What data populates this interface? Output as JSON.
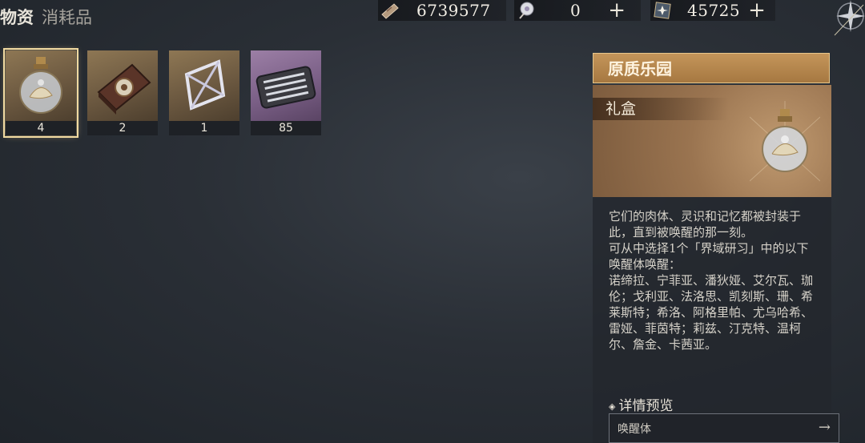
{
  "tabs": {
    "active": "物资",
    "secondary": "消耗品"
  },
  "currencies": [
    {
      "icon": "ticket-currency-icon",
      "value": "6739577",
      "has_plus": false
    },
    {
      "icon": "crystal-currency-icon",
      "value": "0",
      "has_plus": true
    },
    {
      "icon": "star-currency-icon",
      "value": "45725",
      "has_plus": true
    }
  ],
  "plus_symbol": "+",
  "items": [
    {
      "name": "原质乐园",
      "count": "4",
      "icon": "flask-icon",
      "selected": true
    },
    {
      "count": "2",
      "icon": "book-icon",
      "selected": false
    },
    {
      "count": "1",
      "icon": "crystal-frame-icon",
      "selected": false
    },
    {
      "count": "85",
      "icon": "toolkit-icon",
      "selected": false
    }
  ],
  "detail": {
    "title": "原质乐园",
    "type": "礼盒",
    "description": [
      "它们的肉体、灵识和记忆都被封装于此，直到被唤醒的那一刻。",
      "可从中选择1个「界域研习」中的以下唤醒体唤醒：",
      "诺缔拉、宁菲亚、潘狄娅、艾尔瓦、珈伦；戈利亚、法洛思、凯刻斯、珊、希莱斯特；希洛、阿格里帕、尤乌哈希、雷娅、菲茵特；莉兹、汀克特、温柯尔、詹金、卡茜亚。"
    ],
    "preview_label": "详情预览",
    "preview_item": "唤醒体",
    "preview_arrow": "→",
    "diamond": "◈"
  },
  "colors": {
    "accent": "#c4955a",
    "selected_outline": "#f0d9a0",
    "purple_item": "#7a5f86"
  }
}
